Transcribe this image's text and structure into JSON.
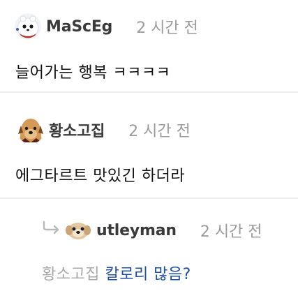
{
  "colors": {
    "divider": "#ececec",
    "author": "#3a3a3a",
    "timestamp": "#9b9b9b",
    "mention": "#a9a9a9",
    "reply_text": "#1e4fa8"
  },
  "comments": [
    {
      "author": "MaScEg",
      "time": "2 시간 전",
      "text": "늘어가는 행복 ㅋㅋㅋㅋ",
      "avatar_icon": "white-creature-avatar-icon"
    },
    {
      "author": "황소고집",
      "time": "2 시간 전",
      "text": "에그타르트 맛있긴 하더라",
      "avatar_icon": "dog-face-avatar-icon"
    }
  ],
  "reply": {
    "author": "utleyman",
    "time": "2 시간 전",
    "mention": "황소고집",
    "text": "칼로리 많음?",
    "avatar_icon": "puppy-avatar-icon",
    "indicator_icon": "reply-arrow-icon"
  }
}
